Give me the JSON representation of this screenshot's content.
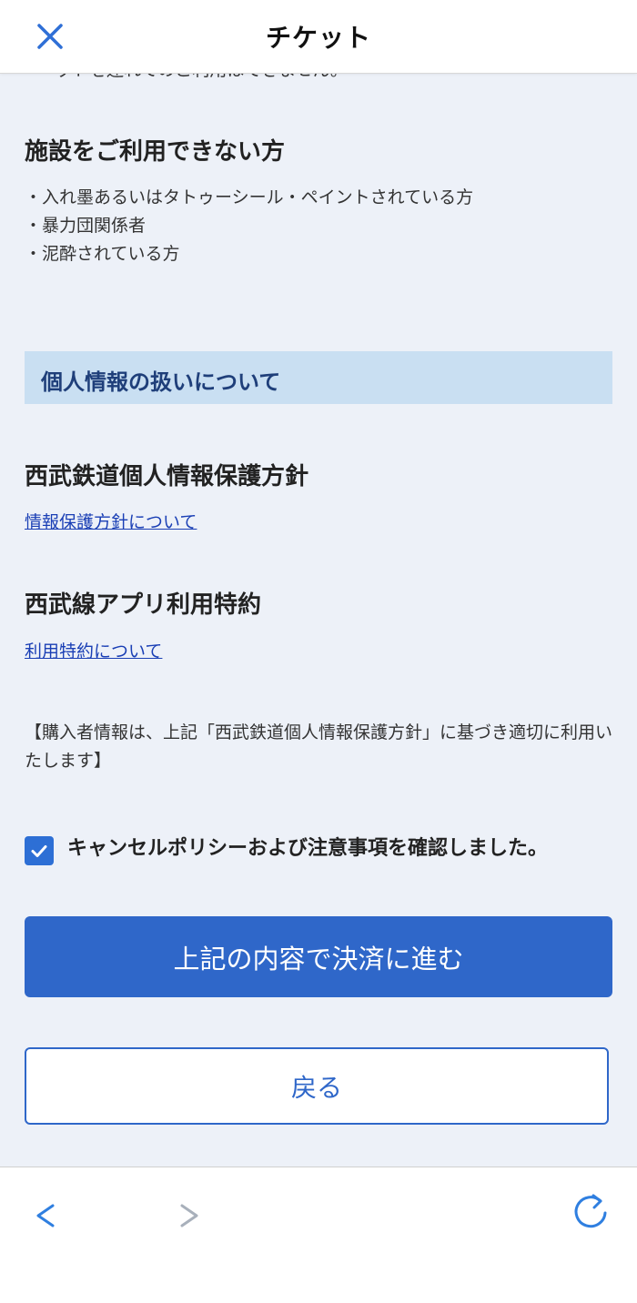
{
  "header": {
    "title": "チケット",
    "close_icon": "close-icon"
  },
  "top_clipped_text": "ットを連れてのご利用はできません。",
  "restrictions": {
    "heading": "施設をご利用できない方",
    "items": [
      "入れ墨あるいはタトゥーシール・ペイントされている方",
      "暴力団関係者",
      "泥酔されている方"
    ]
  },
  "privacy_section": {
    "band_title": "個人情報の扱いについて",
    "policy_heading": "西武鉄道個人情報保護方針",
    "policy_link": "情報保護方針について",
    "terms_heading": "西武線アプリ利用特約",
    "terms_link": "利用特約について",
    "note": "【購入者情報は、上記「西武鉄道個人情報保護方針」に基づき適切に利用いたします】"
  },
  "confirmation": {
    "checked": true,
    "label": "キャンセルポリシーおよび注意事項を確認しました。"
  },
  "buttons": {
    "proceed": "上記の内容で決済に進む",
    "back": "戻る"
  },
  "colors": {
    "accent": "#2f67c9",
    "content_bg": "#edf1f8",
    "section_band": "#c9dff2",
    "link": "#1a3fb5"
  },
  "bottom_nav": {
    "back_icon": "chevron-left-icon",
    "forward_icon": "chevron-right-icon",
    "reload_icon": "reload-icon"
  }
}
